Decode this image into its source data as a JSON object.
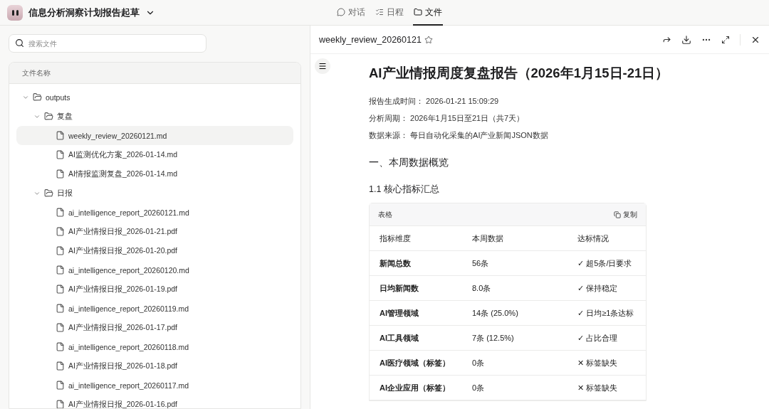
{
  "app": {
    "title": "信息分析洞察计划报告起草"
  },
  "tabs": [
    {
      "label": "对话",
      "selected": false
    },
    {
      "label": "日程",
      "selected": false
    },
    {
      "label": "文件",
      "selected": true
    }
  ],
  "sidebar": {
    "search": {
      "placeholder": "搜索文件"
    },
    "column_header": "文件名称",
    "tree": [
      {
        "kind": "folder",
        "name": "outputs",
        "expanded": true,
        "children": [
          {
            "kind": "folder",
            "name": "复盘",
            "expanded": true,
            "children": [
              {
                "kind": "file",
                "name": "weekly_review_20260121.md",
                "selected": true
              },
              {
                "kind": "file",
                "name": "AI监测优化方案_2026-01-14.md",
                "selected": false
              },
              {
                "kind": "file",
                "name": "AI情报监测复盘_2026-01-14.md",
                "selected": false
              }
            ]
          },
          {
            "kind": "folder",
            "name": "日报",
            "expanded": true,
            "children": [
              {
                "kind": "file",
                "name": "ai_intelligence_report_20260121.md",
                "selected": false
              },
              {
                "kind": "file",
                "name": "AI产业情报日报_2026-01-21.pdf",
                "selected": false
              },
              {
                "kind": "file",
                "name": "AI产业情报日报_2026-01-20.pdf",
                "selected": false
              },
              {
                "kind": "file",
                "name": "ai_intelligence_report_20260120.md",
                "selected": false
              },
              {
                "kind": "file",
                "name": "AI产业情报日报_2026-01-19.pdf",
                "selected": false
              },
              {
                "kind": "file",
                "name": "ai_intelligence_report_20260119.md",
                "selected": false
              },
              {
                "kind": "file",
                "name": "AI产业情报日报_2026-01-17.pdf",
                "selected": false
              },
              {
                "kind": "file",
                "name": "ai_intelligence_report_20260118.md",
                "selected": false
              },
              {
                "kind": "file",
                "name": "AI产业情报日报_2026-01-18.pdf",
                "selected": false
              },
              {
                "kind": "file",
                "name": "ai_intelligence_report_20260117.md",
                "selected": false
              },
              {
                "kind": "file",
                "name": "AI产业情报日报_2026-01-16.pdf",
                "selected": false
              }
            ]
          }
        ]
      }
    ]
  },
  "document": {
    "filename": "weekly_review_20260121",
    "starred": false,
    "title": "AI产业情报周度复盘报告（2026年1月15日-21日）",
    "meta": [
      {
        "label": "报告生成时间：",
        "value": "2026-01-21 15:09:29"
      },
      {
        "label": "分析周期：",
        "value": "2026年1月15日至21日（共7天）"
      },
      {
        "label": "数据来源：",
        "value": "每日自动化采集的AI产业新闻JSON数据"
      }
    ],
    "section": "一、本周数据概览",
    "subsection": "1.1 核心指标汇总",
    "table": {
      "caption": "表格",
      "copy_label": "复制",
      "columns": [
        "指标维度",
        "本周数据",
        "达标情况"
      ],
      "rows": [
        [
          "新闻总数",
          "56条",
          "✓ 超5条/日要求"
        ],
        [
          "日均新闻数",
          "8.0条",
          "✓ 保持稳定"
        ],
        [
          "AI管理领域",
          "14条 (25.0%)",
          "✓ 日均≥1条达标"
        ],
        [
          "AI工具领域",
          "7条 (12.5%)",
          "✓ 占比合理"
        ],
        [
          "AI医疗领域（标签）",
          "0条",
          "✕ 标签缺失"
        ],
        [
          "AI企业应用（标签）",
          "0条",
          "✕ 标签缺失"
        ]
      ]
    }
  }
}
